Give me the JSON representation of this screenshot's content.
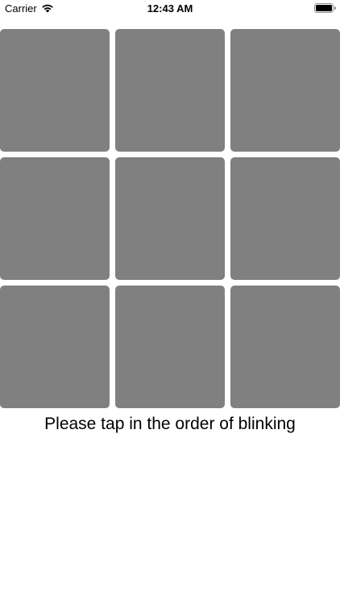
{
  "status_bar": {
    "carrier": "Carrier",
    "time": "12:43 AM",
    "icons": [
      "wifi-icon",
      "battery-icon"
    ],
    "battery_level": 1.0
  },
  "game": {
    "tile_color": "#808080",
    "tiles": [
      {
        "row": 1,
        "column": 1
      },
      {
        "row": 1,
        "column": 2
      },
      {
        "row": 1,
        "column": 3
      },
      {
        "row": 2,
        "column": 1
      },
      {
        "row": 2,
        "column": 2
      },
      {
        "row": 2,
        "column": 3
      },
      {
        "row": 3,
        "column": 1
      },
      {
        "row": 3,
        "column": 2
      },
      {
        "row": 3,
        "column": 3
      }
    ],
    "instruction": "Please tap in the order of blinking"
  }
}
